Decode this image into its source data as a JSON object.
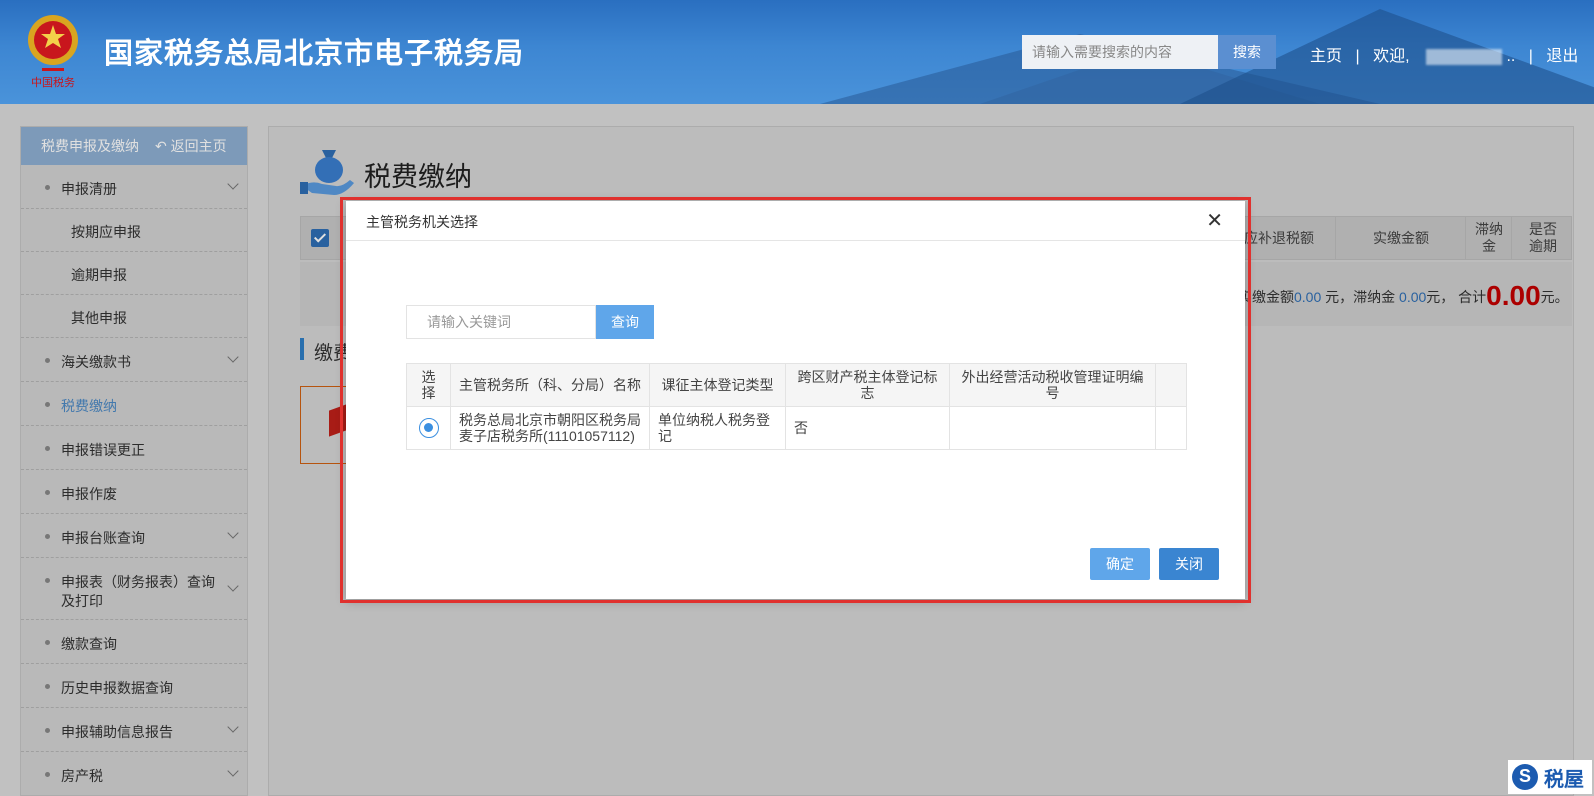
{
  "header": {
    "site_title": "国家税务总局北京市电子税务局",
    "search_placeholder": "请输入需要搜索的内容",
    "search_button": "搜索",
    "nav_home": "主页",
    "nav_sep": "|",
    "nav_welcome": "欢迎,",
    "nav_user_suffix": "..",
    "nav_logout": "退出",
    "emblem_text": "中国税务"
  },
  "sidebar": {
    "header_title": "税费申报及缴纳",
    "back_label": "返回主页",
    "items": [
      {
        "label": "申报清册",
        "expandable": true
      },
      {
        "label": "按期应申报",
        "sub": true
      },
      {
        "label": "逾期申报",
        "sub": true
      },
      {
        "label": "其他申报",
        "sub": true
      },
      {
        "label": "海关缴款书",
        "expandable": true
      },
      {
        "label": "税费缴纳",
        "active": true
      },
      {
        "label": "申报错误更正"
      },
      {
        "label": "申报作废"
      },
      {
        "label": "申报台账查询",
        "expandable": true
      },
      {
        "label": "申报表（财务报表）查询",
        "label2": "及打印",
        "expandable": true
      },
      {
        "label": "缴款查询"
      },
      {
        "label": "历史申报数据查询"
      },
      {
        "label": "申报辅助信息报告",
        "expandable": true
      },
      {
        "label": "房产税",
        "expandable": true
      }
    ]
  },
  "main": {
    "page_title": "税费缴纳",
    "table_headers": {
      "col_partial": "应补退税额",
      "col_paid": "实缴金额",
      "col_late_fee_1": "滞纳",
      "col_late_fee_2": "金",
      "col_overdue_1": "是否",
      "col_overdue_2": "逾期"
    },
    "summary": {
      "prefix": "实缴金额",
      "paid_amount": "0.00",
      "unit1": " 元，滞纳金 ",
      "late_amount": "0.00",
      "unit2": "元，  合计",
      "total": "0.00",
      "unit3": "元。"
    },
    "section_title": "缴费"
  },
  "modal": {
    "title": "主管税务机关选择",
    "close_glyph": "✕",
    "keyword_placeholder": "请输入关键词",
    "query_button": "查询",
    "columns": [
      "选择",
      "主管税务所（科、分局）名称",
      "课征主体登记类型",
      "跨区财产税主体登记标志",
      "外出经营活动税收管理证明编号"
    ],
    "rows": [
      {
        "selected": true,
        "office": "税务总局北京市朝阳区税务局麦子店税务所(11101057112)",
        "reg_type": "单位纳税人税务登记",
        "cross_region": "否",
        "cert_no": ""
      }
    ],
    "ok_button": "确定",
    "close_button": "关闭"
  },
  "watermark": {
    "text": "税屋"
  },
  "colors": {
    "header_blue": "#3d86d2",
    "accent_blue": "#5fa6ea",
    "highlight_red": "#e0312e",
    "total_red": "#c40000"
  }
}
